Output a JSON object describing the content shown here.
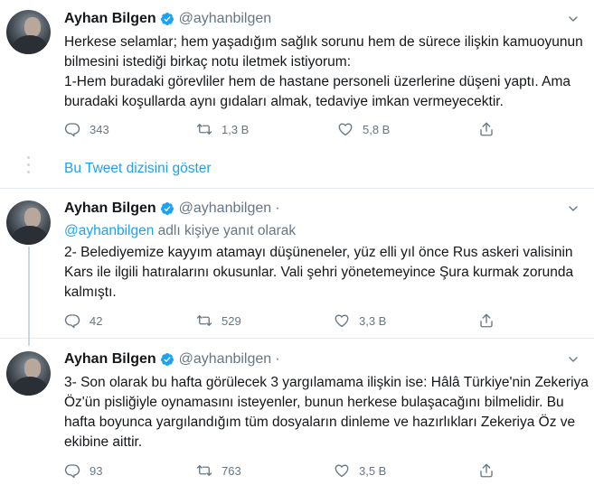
{
  "colors": {
    "accent": "#1da1f2",
    "muted": "#657786",
    "text": "#14171a"
  },
  "tweets": [
    {
      "name": "Ayhan Bilgen",
      "handle": "@ayhanbilgen",
      "replying": null,
      "text": "Herkese selamlar; hem yaşadığım sağlık sorunu hem de sürece ilişkin kamuoyunun bilmesini istediği birkaç notu iletmek istiyorum:\n1-Hem buradaki görevliler hem de hastane personeli üzerlerine düşeni yaptı. Ama buradaki koşullarda aynı gıdaları almak, tedaviye imkan vermeyecektir.",
      "replies": "343",
      "retweets": "1,3 B",
      "likes": "5,8 B"
    },
    {
      "name": "Ayhan Bilgen",
      "handle": "@ayhanbilgen",
      "dot": "·",
      "replying_handle": "@ayhanbilgen",
      "replying_suffix": " adlı kişiye yanıt olarak",
      "text": "2- Belediyemize kayyım atamayı düşüneneler, yüz elli yıl önce Rus askeri valisinin Kars ile ilgili hatıralarını okusunlar. Vali şehri yönetemeyince Şura kurmak zorunda kalmıştı.",
      "replies": "42",
      "retweets": "529",
      "likes": "3,3 B"
    },
    {
      "name": "Ayhan Bilgen",
      "handle": "@ayhanbilgen",
      "dot": "·",
      "text": "3- Son olarak bu hafta görülecek 3 yargılamama ilişkin ise: Hâlâ Türkiye'nin Zekeriya Öz'ün pisliğiyle oynamasını isteyenler, bunun herkese bulaşacağını bilmelidir. Bu hafta boyunca yargılandığım tüm dosyaların dinleme ve hazırlıkları Zekeriya Öz ve ekibine aittir.",
      "replies": "93",
      "retweets": "763",
      "likes": "3,5 B"
    }
  ],
  "show_thread": "Bu Tweet dizisini göster",
  "icons": [
    "verified-icon",
    "chevron-down-icon",
    "reply-icon",
    "retweet-icon",
    "like-icon",
    "share-icon"
  ]
}
